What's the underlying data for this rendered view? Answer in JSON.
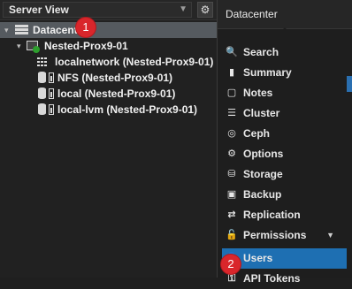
{
  "left_panel": {
    "view_select": "Server View",
    "tree": {
      "datacenter": "Datacenter",
      "node": "Nested-Prox9-01",
      "items": [
        {
          "label": "localnetwork (Nested-Prox9-01)",
          "icon": "network-grid-icon"
        },
        {
          "label": "NFS (Nested-Prox9-01)",
          "icon": "storage-icon"
        },
        {
          "label": "local (Nested-Prox9-01)",
          "icon": "storage-icon"
        },
        {
          "label": "local-lvm (Nested-Prox9-01)",
          "icon": "storage-icon"
        }
      ]
    }
  },
  "annotations": {
    "badge1": "1",
    "badge2": "2"
  },
  "right_panel": {
    "header": "Datacenter",
    "menu": [
      {
        "label": "Search",
        "icon": "search-icon",
        "glyph": "🔍"
      },
      {
        "label": "Summary",
        "icon": "book-icon",
        "glyph": "▮"
      },
      {
        "label": "Notes",
        "icon": "notes-icon",
        "glyph": "▢"
      },
      {
        "label": "Cluster",
        "icon": "server-icon",
        "glyph": "☰"
      },
      {
        "label": "Ceph",
        "icon": "ceph-icon",
        "glyph": "◎"
      },
      {
        "label": "Options",
        "icon": "gear-icon",
        "glyph": "⚙"
      },
      {
        "label": "Storage",
        "icon": "database-icon",
        "glyph": "⛁"
      },
      {
        "label": "Backup",
        "icon": "floppy-icon",
        "glyph": "▣"
      },
      {
        "label": "Replication",
        "icon": "retweet-icon",
        "glyph": "⇄"
      },
      {
        "label": "Permissions",
        "icon": "unlock-icon",
        "glyph": "🔓"
      },
      {
        "label": "Users",
        "icon": "user-icon",
        "glyph": "👤"
      },
      {
        "label": "API Tokens",
        "icon": "key-icon",
        "glyph": "⚿"
      }
    ]
  },
  "colors": {
    "selection": "#1e6fb2",
    "badge": "#d9262b",
    "tree_selected": "#555a5f"
  }
}
